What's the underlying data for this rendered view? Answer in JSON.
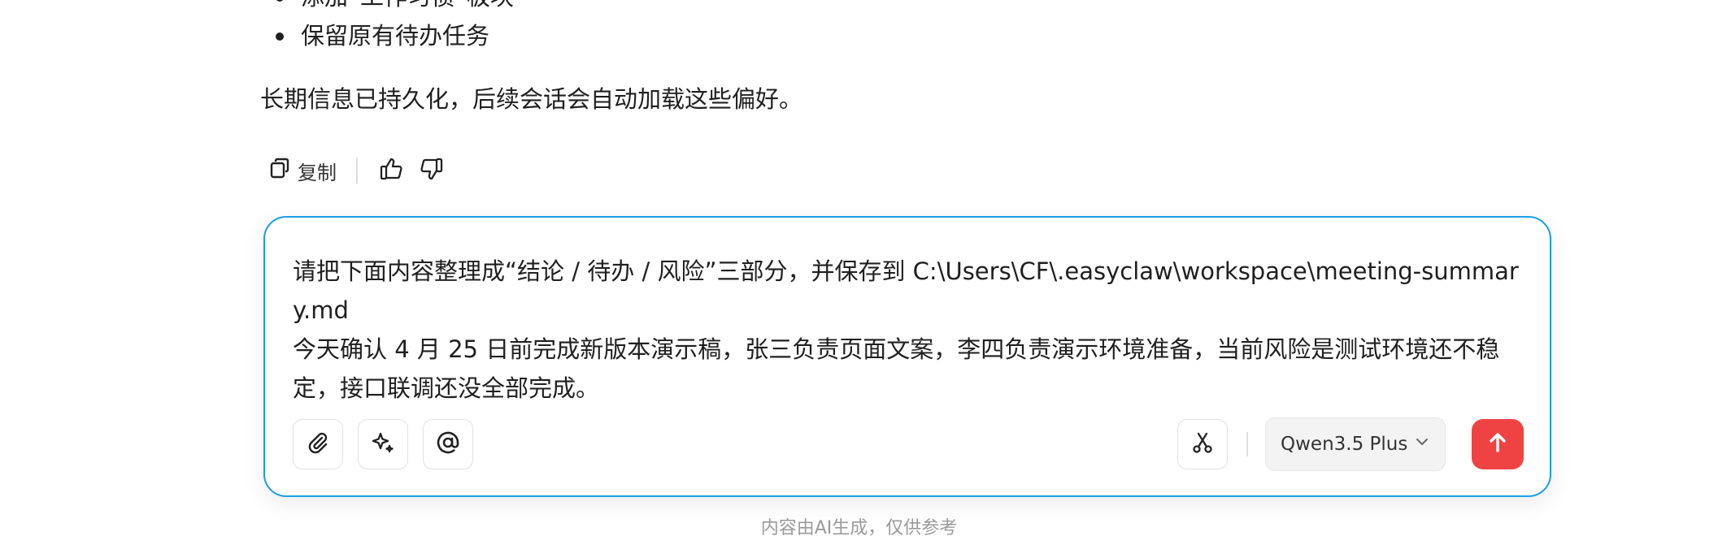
{
  "message": {
    "bullets": [
      "添加“工作习惯”板块",
      "保留原有待办任务"
    ],
    "summary": "长期信息已持久化，后续会话会自动加载这些偏好。"
  },
  "actions": {
    "copy_label": "复制",
    "icons": [
      "copy-icon",
      "thumbs-up-icon",
      "thumbs-down-icon"
    ]
  },
  "composer": {
    "text": "请把下面内容整理成“结论 / 待办 / 风险”三部分，并保存到 C:\\Users\\CF\\.easyclaw\\workspace\\meeting-summary.md\n今天确认 4 月 25 日前完成新版本演示稿，张三负责页面文案，李四负责演示环境准备，当前风险是测试环境还不稳定，接口联调还没全部完成。",
    "tools": [
      "attach-icon",
      "sparkle-icon",
      "at-icon",
      "scissors-icon"
    ],
    "model": "Qwen3.5 Plus",
    "accent_color": "#1a9ee6",
    "send_color": "#ef4343"
  },
  "footer": {
    "disclaimer": "内容由AI生成，仅供参考"
  }
}
